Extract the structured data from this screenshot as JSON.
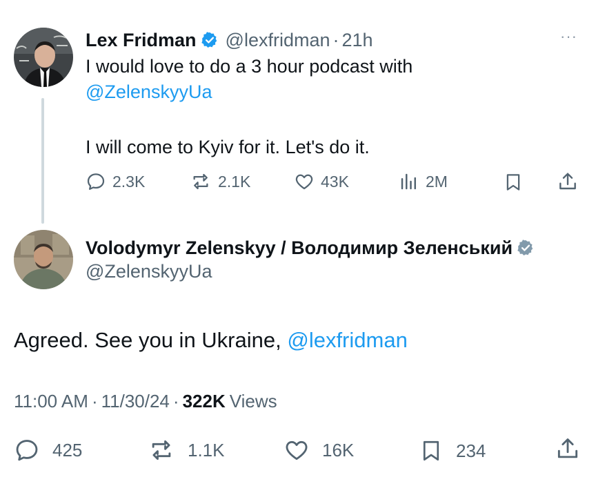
{
  "parent_tweet": {
    "author_name": "Lex Fridman",
    "handle": "@lexfridman",
    "separator": "·",
    "time": "21h",
    "more_label": "···",
    "text_line1": "I would love to do a 3 hour podcast with",
    "mention": "@ZelenskyyUa",
    "text_line3": "I will come to Kyiv for it. Let's do it.",
    "replies": "2.3K",
    "reposts": "2.1K",
    "likes": "43K",
    "views": "2M",
    "verified_color": "#1d9bf0"
  },
  "main_tweet": {
    "author_name": "Volodymyr Zelenskyy / Володимир Зеленський",
    "handle": "@ZelenskyyUa",
    "text": "Agreed. See you in Ukraine, ",
    "mention": "@lexfridman",
    "time": "11:00 AM",
    "dot1": "·",
    "date": "11/30/24",
    "dot2": "·",
    "views_count": "322K",
    "views_label": "Views",
    "replies": "425",
    "reposts": "1.1K",
    "likes": "16K",
    "bookmarks": "234",
    "verified_color": "#829aab"
  },
  "colors": {
    "text": "#0f1419",
    "secondary": "#536471",
    "link": "#1d9bf0",
    "thread_line": "#cfd9de"
  }
}
